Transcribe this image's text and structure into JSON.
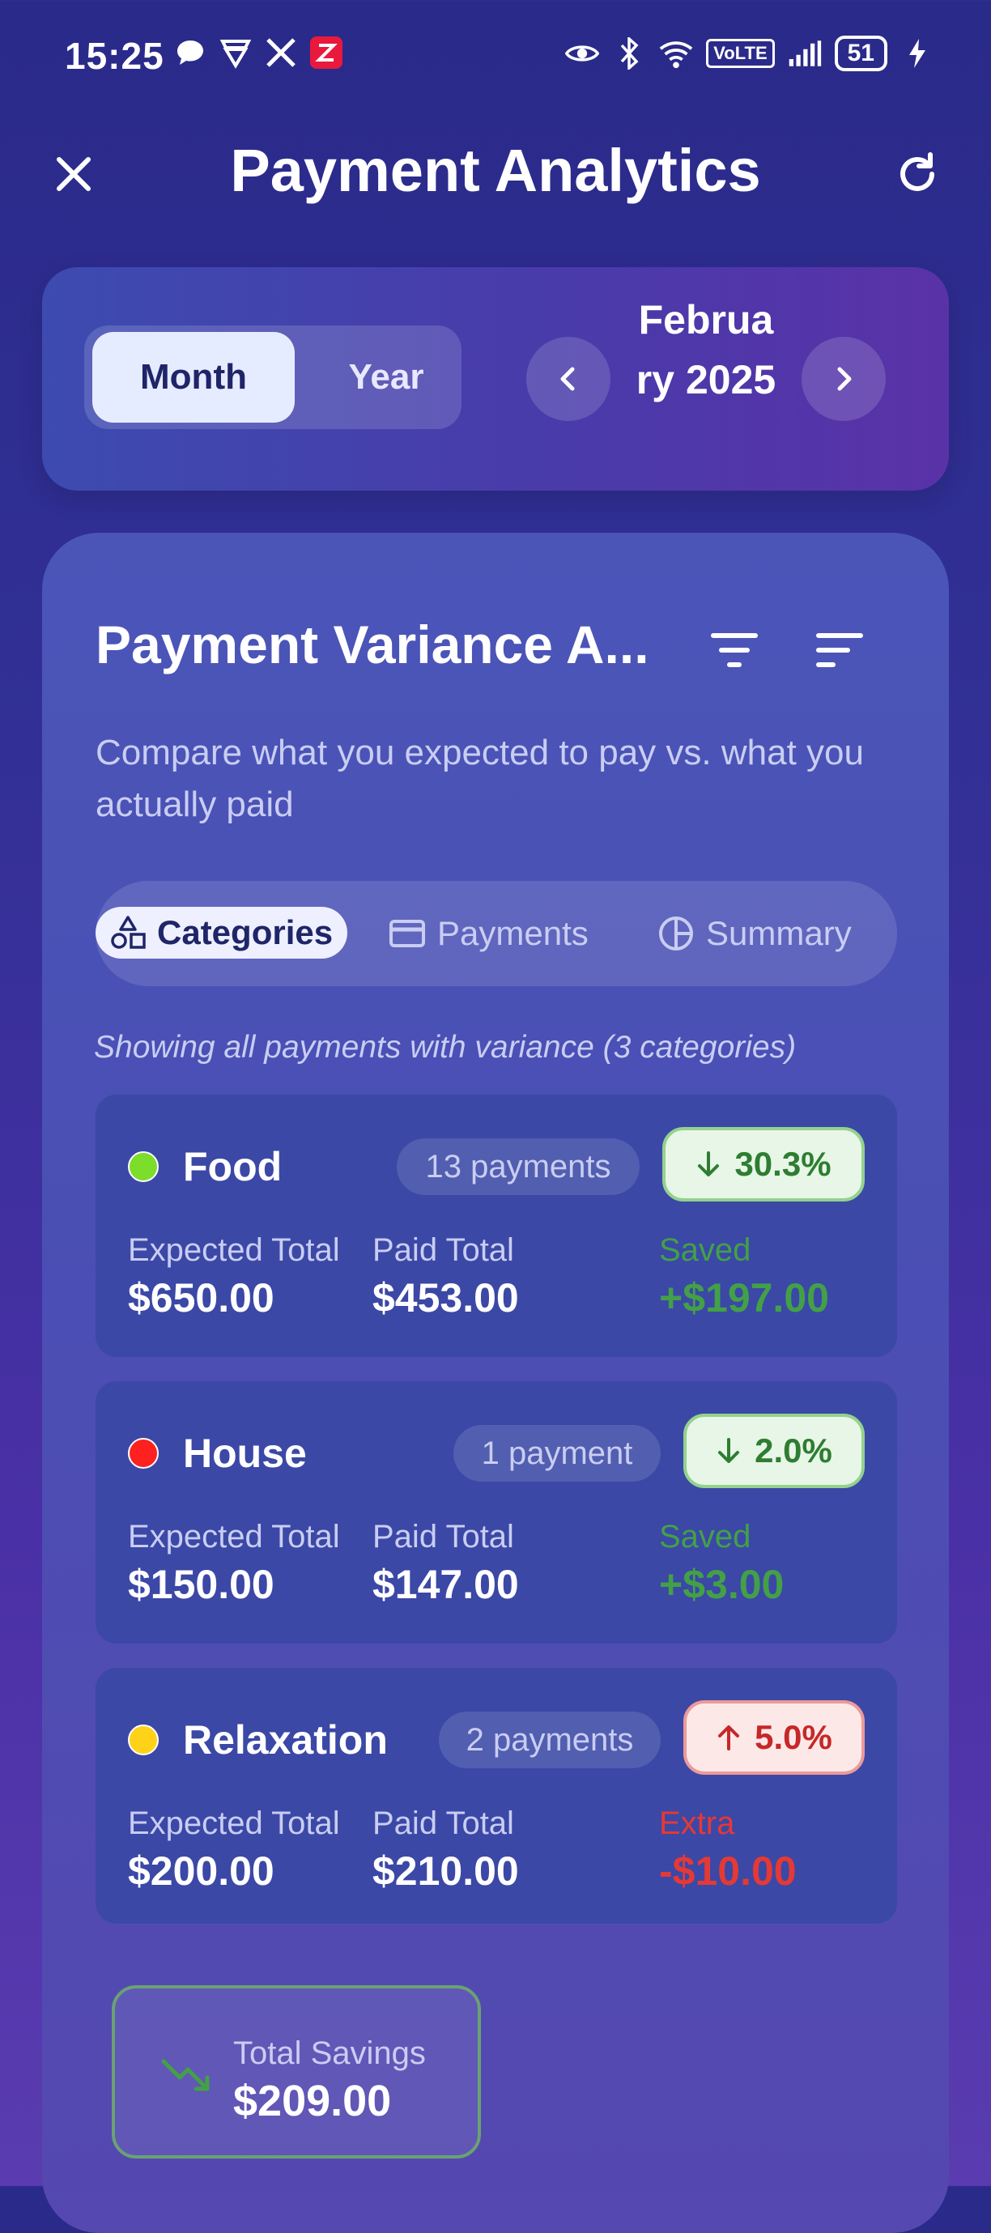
{
  "status_bar": {
    "time": "15:25",
    "volte": "VoLTE",
    "battery": "51"
  },
  "header": {
    "title": "Payment Analytics"
  },
  "period": {
    "mode_month": "Month",
    "mode_year": "Year",
    "selected_mode": "Month",
    "label": "Februa ry 2025"
  },
  "variance": {
    "title": "Payment Variance A...",
    "subtitle": "Compare what you expected to pay vs. what you actually paid",
    "tabs": [
      {
        "label": "Categories",
        "icon": "shapes-icon",
        "active": true
      },
      {
        "label": "Payments",
        "icon": "credit-card-icon",
        "active": false
      },
      {
        "label": "Summary",
        "icon": "pie-chart-icon",
        "active": false
      }
    ],
    "showing_text": "Showing all payments with variance (3 categories)",
    "categories": [
      {
        "name": "Food",
        "color": "#7cdd2a",
        "count": "13 payments",
        "pct": "30.3%",
        "direction": "down",
        "expected_label": "Expected Total",
        "expected": "$650.00",
        "paid_label": "Paid Total",
        "paid": "$453.00",
        "diff_label": "Saved",
        "diff": "+$197.00"
      },
      {
        "name": "House",
        "color": "#ff2020",
        "count": "1 payment",
        "pct": "2.0%",
        "direction": "down",
        "expected_label": "Expected Total",
        "expected": "$150.00",
        "paid_label": "Paid Total",
        "paid": "$147.00",
        "diff_label": "Saved",
        "diff": "+$3.00"
      },
      {
        "name": "Relaxation",
        "color": "#ffd21a",
        "count": "2 payments",
        "pct": "5.0%",
        "direction": "up",
        "expected_label": "Expected Total",
        "expected": "$200.00",
        "paid_label": "Paid Total",
        "paid": "$210.00",
        "diff_label": "Extra",
        "diff": "-$10.00"
      }
    ],
    "total_savings": {
      "label": "Total Savings",
      "value": "$209.00"
    }
  },
  "colors": {
    "saved": "#43a047",
    "extra": "#e53935",
    "accent_active_tab": "#eef0ff"
  }
}
